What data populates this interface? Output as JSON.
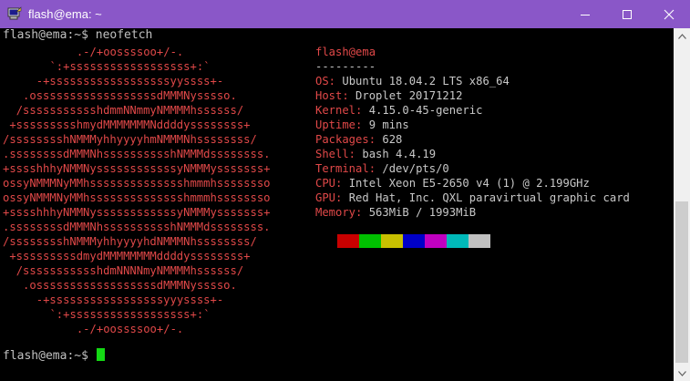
{
  "window": {
    "title": "flash@ema: ~"
  },
  "prompt": {
    "command_line": "flash@ema:~$ neofetch",
    "prompt_text": "flash@ema:~$ "
  },
  "logo": [
    {
      "text": ".-/+oossssoo+/-.",
      "indent": 11
    },
    {
      "text": "`:+ssssssssssssssssss+:`",
      "indent": 7
    },
    {
      "text": "-+ssssssssssssssssssyyssss+-",
      "indent": 5
    },
    {
      "text": ".ossssssssssssssssssdMMMNysssso.",
      "indent": 3
    },
    {
      "text": "/ssssssssssshdmmNNmmyNMMMMhssssss/",
      "indent": 2
    },
    {
      "text": "+ssssssssshmydMMMMMMMNddddyssssssss+",
      "indent": 1
    },
    {
      "text": "/sssssssshNMMMyhhyyyyhmNMMMNhssssssss/",
      "indent": 0
    },
    {
      "text": ".ssssssssdMMMNhsssssssssshNMMMdssssssss.",
      "indent": 0
    },
    {
      "text": "+sssshhhyNMMNyssssssssssssyNMMMysssssss+",
      "indent": 0
    },
    {
      "text": "ossyNMMMNyMMhsssssssssssssshmmmhssssssso",
      "indent": 0
    },
    {
      "text": "ossyNMMMNyMMhsssssssssssssshmmmhssssssso",
      "indent": 0
    },
    {
      "text": "+sssshhhyNMMNyssssssssssssyNMMMysssssss+",
      "indent": 0
    },
    {
      "text": ".ssssssssdMMMNhsssssssssshNMMMdssssssss.",
      "indent": 0
    },
    {
      "text": "/sssssssshNMMMyhhyyyyhdNMMMNhssssssss/",
      "indent": 0
    },
    {
      "text": "+sssssssssdmydMMMMMMMMddddyssssssss+",
      "indent": 1
    },
    {
      "text": "/ssssssssssshdmNNNNmyNMMMMhssssss/",
      "indent": 2
    },
    {
      "text": ".ossssssssssssssssssdMMMNysssso.",
      "indent": 3
    },
    {
      "text": "-+sssssssssssssssssyyyssss+-",
      "indent": 5
    },
    {
      "text": "`:+ssssssssssssssssss+:`",
      "indent": 7
    },
    {
      "text": ".-/+oossssoo+/-.",
      "indent": 11
    }
  ],
  "info": {
    "user_host": "flash@ema",
    "separator": "---------",
    "rows": [
      {
        "key": "OS",
        "value": "Ubuntu 18.04.2 LTS x86_64"
      },
      {
        "key": "Host",
        "value": "Droplet 20171212"
      },
      {
        "key": "Kernel",
        "value": "4.15.0-45-generic"
      },
      {
        "key": "Uptime",
        "value": "9 mins"
      },
      {
        "key": "Packages",
        "value": "628"
      },
      {
        "key": "Shell",
        "value": "bash 4.4.19"
      },
      {
        "key": "Terminal",
        "value": "/dev/pts/0"
      },
      {
        "key": "CPU",
        "value": "Intel Xeon E5-2650 v4 (1) @ 2.199GHz"
      },
      {
        "key": "GPU",
        "value": "Red Hat, Inc. QXL paravirtual graphic card"
      },
      {
        "key": "Memory",
        "value": "563MiB / 1993MiB"
      }
    ]
  },
  "palette": [
    "#c80000",
    "#00c000",
    "#c8c000",
    "#0000c8",
    "#c000c0",
    "#00b8b8",
    "#c0c0c0"
  ],
  "colors": {
    "title_bar": "#8a57c8",
    "accent_red": "#e04848",
    "cursor": "#14d914"
  }
}
